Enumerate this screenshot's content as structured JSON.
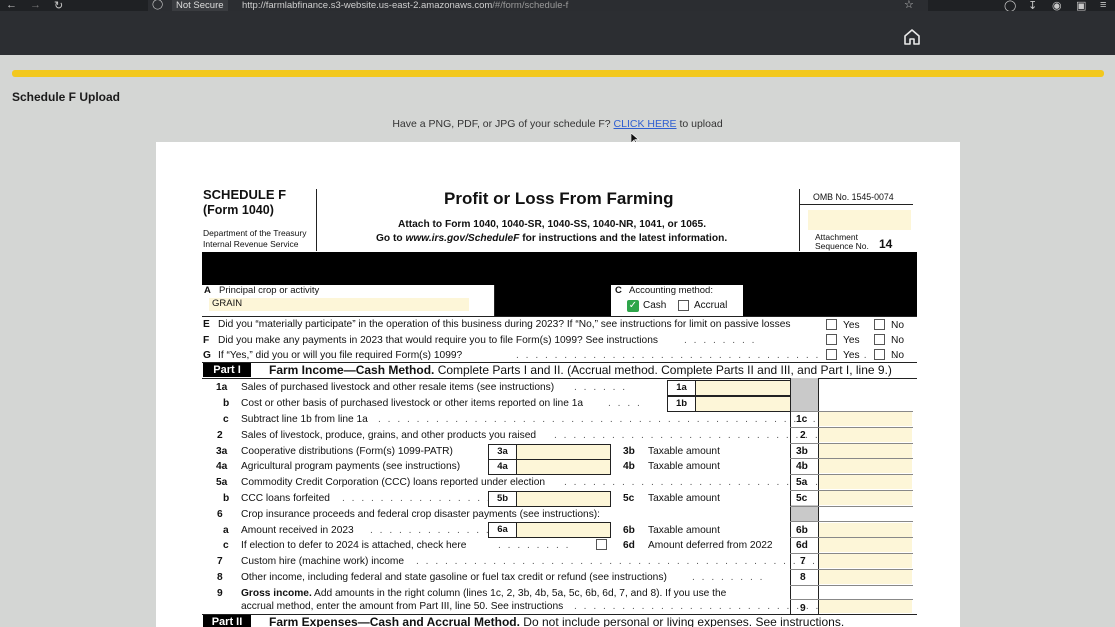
{
  "browser": {
    "not_secure_label": "Not Secure",
    "url_host": "http://farmlabfinance.s3-website.us-east-2.amazonaws.com",
    "url_path": "/#/form/schedule-f"
  },
  "page": {
    "title": "Schedule F Upload",
    "upload_prompt": "Have a PNG, PDF, or JPG of your schedule F? ",
    "upload_link": "CLICK HERE",
    "upload_suffix": " to upload"
  },
  "form": {
    "schedule": "SCHEDULE F",
    "form_no": "(Form 1040)",
    "dept1": "Department of the Treasury",
    "dept2": "Internal Revenue Service",
    "title": "Profit or Loss From Farming",
    "attach": "Attach to Form 1040, 1040-SR, 1040-SS, 1040-NR, 1041, or 1065.",
    "goto_pre": "Go to ",
    "goto_url": "www.irs.gov/ScheduleF",
    "goto_post": " for instructions and the latest information.",
    "omb": "OMB No. 1545-0074",
    "attachment_label1": "Attachment",
    "attachment_label2": "Sequence No.",
    "attachment_no": "14",
    "A_letter": "A",
    "A_label": "Principal crop or activity",
    "A_value": "GRAIN",
    "C_letter": "C",
    "C_label": "Accounting method:",
    "cash_label": "Cash",
    "accrual_label": "Accrual",
    "yes": "Yes",
    "no": "No",
    "E_letter": "E",
    "E_text": "Did you “materially participate” in the operation of this business during 2023? If “No,” see instructions for limit on passive losses",
    "F_letter": "F",
    "F_text": "Did you make any payments in 2023 that would require you to file Form(s) 1099? See instructions",
    "G_letter": "G",
    "G_text": "If “Yes,” did you or will you file required Form(s) 1099?",
    "part1_tag": "Part I",
    "part1_title": "Farm Income—Cash Method.",
    "part1_sub": " Complete Parts I and II. (Accrual method. Complete Parts II and III, and Part I, line 9.)",
    "part2_tag": "Part II",
    "part2_title": "Farm Expenses—Cash and Accrual Method.",
    "part2_sub": " Do not include personal or living expenses. See instructions.",
    "lines": {
      "l1a_no": "1a",
      "l1a": "Sales of purchased livestock and other resale items (see instructions)",
      "l1a_box": "1a",
      "l1b_no": "b",
      "l1b": "Cost or other basis of purchased livestock or other items reported on line 1a",
      "l1b_box": "1b",
      "l1c_no": "c",
      "l1c": "Subtract line 1b from line 1a",
      "l1c_box": "1c",
      "l2_no": "2",
      "l2": "Sales of livestock, produce, grains, and other products you raised",
      "l2_box": "2",
      "l3a_no": "3a",
      "l3a": "Cooperative distributions (Form(s) 1099-PATR)",
      "l3a_box": "3a",
      "l3b_no": "3b",
      "l3b": "Taxable amount",
      "l3b_box": "3b",
      "l4a_no": "4a",
      "l4a": "Agricultural program payments (see instructions)",
      "l4a_box": "4a",
      "l4b_no": "4b",
      "l4b": "Taxable amount",
      "l4b_box": "4b",
      "l5a_no": "5a",
      "l5a": "Commodity Credit Corporation (CCC) loans reported under election",
      "l5a_box": "5a",
      "l5b_no": "b",
      "l5b": "CCC loans forfeited",
      "l5b_box": "5b",
      "l5c_no": "5c",
      "l5c": "Taxable amount",
      "l5c_box": "5c",
      "l6_no": "6",
      "l6": "Crop insurance proceeds and federal crop disaster payments (see instructions):",
      "l6a_no": "a",
      "l6a": "Amount received in 2023",
      "l6a_box": "6a",
      "l6b_no": "6b",
      "l6b": "Taxable amount",
      "l6b_box": "6b",
      "l6c_no": "c",
      "l6c": "If election to defer to 2024 is attached, check here",
      "l6d_no": "6d",
      "l6d": "Amount deferred from 2022",
      "l6d_box": "6d",
      "l7_no": "7",
      "l7": "Custom hire (machine work) income",
      "l7_box": "7",
      "l8_no": "8",
      "l8": "Other income, including federal and state gasoline or fuel tax credit or refund (see instructions)",
      "l8_box": "8",
      "l9_no": "9",
      "l9_bold": "Gross income.",
      "l9": " Add amounts in the right column (lines 1c, 2, 3b, 4b, 5a, 5c, 6b, 6d, 7, and 8). If you use the",
      "l9_2": "accrual method, enter the amount from Part III, line 50. See instructions",
      "l9_box": "9"
    }
  }
}
